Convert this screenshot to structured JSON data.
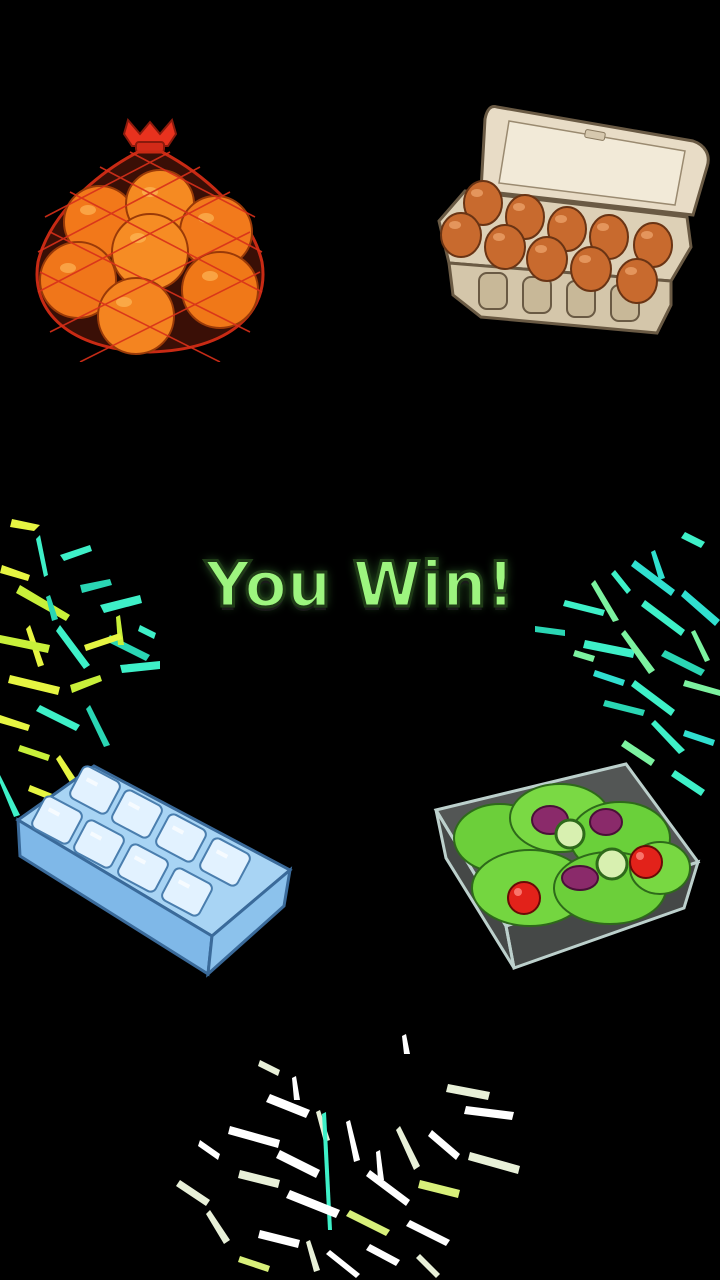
{
  "message": "You Win!",
  "colors": {
    "background": "#000000",
    "win_text": "#9df57f",
    "win_text_outline": "#1f3b17"
  },
  "items": [
    {
      "name": "oranges-net-bag",
      "icon": "oranges-bag-icon"
    },
    {
      "name": "egg-carton",
      "icon": "egg-carton-icon"
    },
    {
      "name": "ice-cube-tray",
      "icon": "ice-tray-icon"
    },
    {
      "name": "salad-container",
      "icon": "salad-box-icon"
    }
  ],
  "confetti_bursts": [
    {
      "name": "left",
      "colors": [
        "#e6f542",
        "#c8f03a",
        "#3ef0c8",
        "#2ad6b4"
      ]
    },
    {
      "name": "right",
      "colors": [
        "#3ef0c8",
        "#30e0d0",
        "#7cf2a0",
        "#2ad6b4"
      ]
    },
    {
      "name": "bottom",
      "colors": [
        "#ffffff",
        "#e8f0d8",
        "#d8f07a",
        "#3ef0c8"
      ]
    }
  ]
}
